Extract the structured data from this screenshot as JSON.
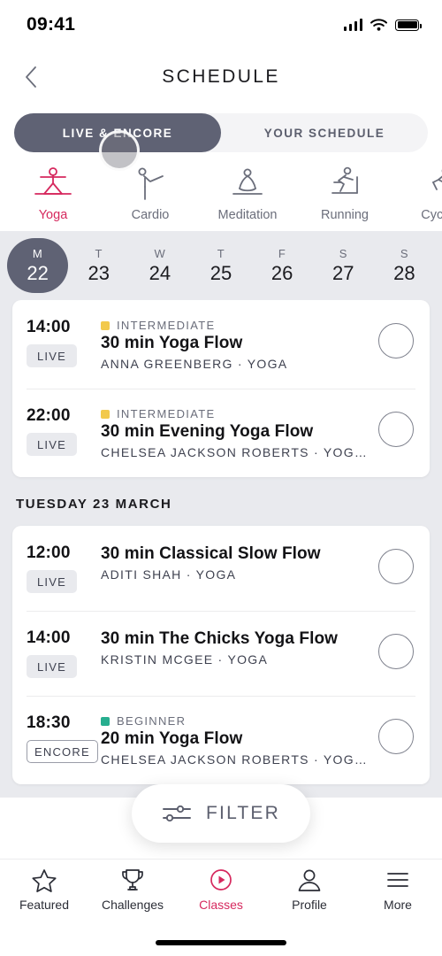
{
  "status_bar": {
    "time": "09:41",
    "signal_icon": "signal-bars-icon",
    "wifi_icon": "wifi-icon",
    "battery_icon": "battery-full-icon"
  },
  "header": {
    "back_icon": "chevron-left-icon",
    "title": "SCHEDULE"
  },
  "segmented": {
    "tabs": [
      {
        "label": "LIVE & ENCORE",
        "active": true
      },
      {
        "label": "YOUR SCHEDULE",
        "active": false
      }
    ]
  },
  "categories": [
    {
      "label": "Yoga",
      "icon": "yoga-icon",
      "active": true
    },
    {
      "label": "Cardio",
      "icon": "cardio-icon",
      "active": false
    },
    {
      "label": "Meditation",
      "icon": "meditation-icon",
      "active": false
    },
    {
      "label": "Running",
      "icon": "running-icon",
      "active": false
    },
    {
      "label": "Cycling",
      "icon": "cycling-icon",
      "active": false
    }
  ],
  "dates": [
    {
      "dow": "M",
      "num": "22",
      "active": true
    },
    {
      "dow": "T",
      "num": "23",
      "active": false
    },
    {
      "dow": "W",
      "num": "24",
      "active": false
    },
    {
      "dow": "T",
      "num": "25",
      "active": false
    },
    {
      "dow": "F",
      "num": "26",
      "active": false
    },
    {
      "dow": "S",
      "num": "27",
      "active": false
    },
    {
      "dow": "S",
      "num": "28",
      "active": false
    }
  ],
  "monday_classes": [
    {
      "time": "14:00",
      "badge": "LIVE",
      "difficulty": "INTERMEDIATE",
      "difficulty_color": "#f2c94c",
      "title": "30 min Yoga Flow",
      "meta": "ANNA GREENBERG  ·  YOGA"
    },
    {
      "time": "22:00",
      "badge": "LIVE",
      "difficulty": "INTERMEDIATE",
      "difficulty_color": "#f2c94c",
      "title": "30 min Evening Yoga Flow",
      "meta": "CHELSEA JACKSON ROBERTS  ·  YOG…"
    }
  ],
  "tuesday_section": {
    "header": "TUESDAY 23 MARCH",
    "classes": [
      {
        "time": "12:00",
        "badge": "LIVE",
        "difficulty": "",
        "difficulty_color": "",
        "title": "30 min Classical Slow Flow",
        "meta": "ADITI SHAH  ·  YOGA"
      },
      {
        "time": "14:00",
        "badge": "LIVE",
        "difficulty": "",
        "difficulty_color": "",
        "title": "30 min The Chicks Yoga Flow",
        "meta": "KRISTIN MCGEE  ·  YOGA"
      },
      {
        "time": "18:30",
        "badge": "ENCORE",
        "difficulty": "BEGINNER",
        "difficulty_color": "#27ae8f",
        "title": "20 min Yoga Flow",
        "meta": "CHELSEA JACKSON ROBERTS  ·  YOG…"
      }
    ]
  },
  "filter_button": {
    "label": "FILTER",
    "icon": "sliders-icon"
  },
  "tabbar": [
    {
      "label": "Featured",
      "icon": "star-icon",
      "active": false
    },
    {
      "label": "Challenges",
      "icon": "trophy-icon",
      "active": false
    },
    {
      "label": "Classes",
      "icon": "play-circle-icon",
      "active": true
    },
    {
      "label": "Profile",
      "icon": "person-icon",
      "active": false
    },
    {
      "label": "More",
      "icon": "hamburger-icon",
      "active": false
    }
  ],
  "colors": {
    "accent": "#d6295e",
    "dark_slate": "#5f6274",
    "strip_bg": "#e9eaee"
  }
}
